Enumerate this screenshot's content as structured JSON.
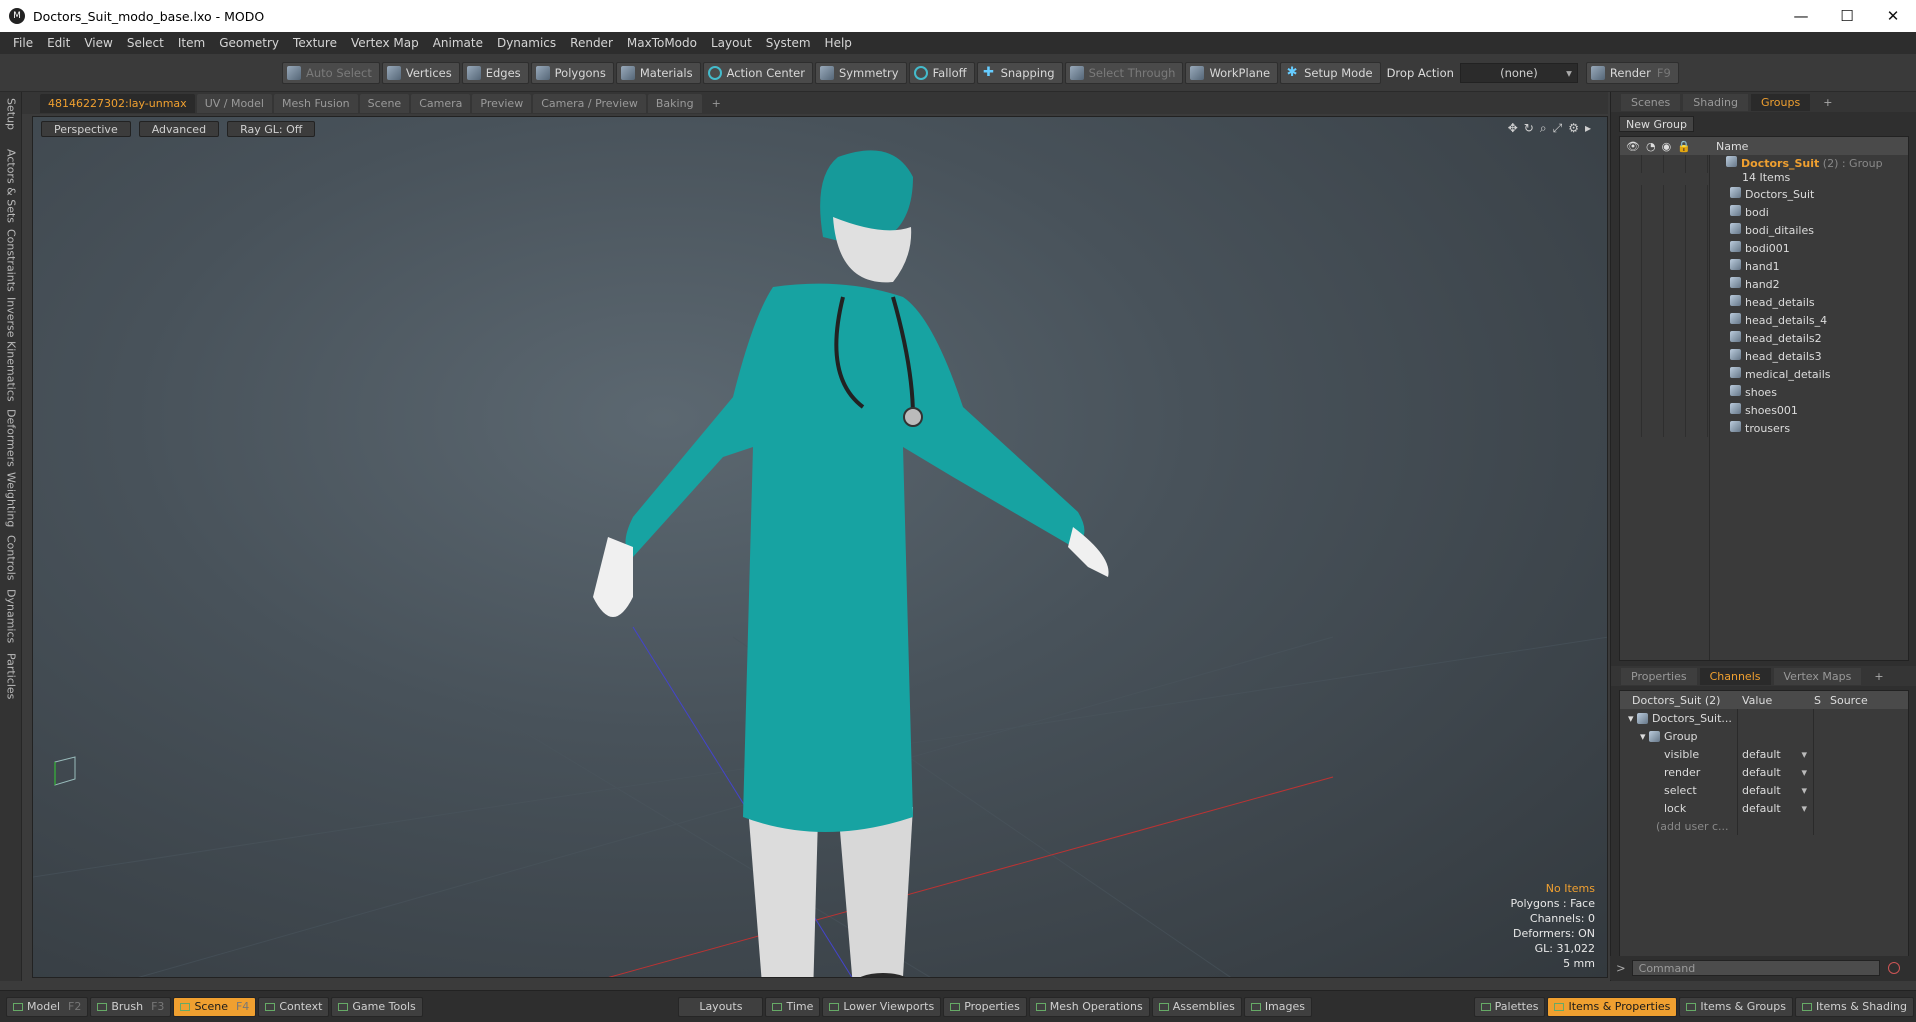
{
  "window": {
    "title": "Doctors_Suit_modo_base.lxo - MODO",
    "min": "—",
    "max": "☐",
    "close": "✕"
  },
  "menu": [
    "File",
    "Edit",
    "View",
    "Select",
    "Item",
    "Geometry",
    "Texture",
    "Vertex Map",
    "Animate",
    "Dynamics",
    "Render",
    "MaxToModo",
    "Layout",
    "System",
    "Help"
  ],
  "toolbar": {
    "auto_select": "Auto Select",
    "vertices": "Vertices",
    "edges": "Edges",
    "polygons": "Polygons",
    "materials": "Materials",
    "action_center": "Action Center",
    "symmetry": "Symmetry",
    "falloff": "Falloff",
    "snapping": "Snapping",
    "select_through": "Select Through",
    "workplane": "WorkPlane",
    "setup_mode": "Setup Mode",
    "drop_action": "Drop Action",
    "drop_value": "(none)",
    "render": "Render",
    "render_key": "F9"
  },
  "left_tabs": [
    "Setup",
    "Actors & Sets",
    "Constraints",
    "Inverse Kinematics",
    "Deformers",
    "Weighting",
    "Controls",
    "Dynamics",
    "Particles"
  ],
  "viewport_tabs": [
    "48146227302:lay-unmax",
    "UV / Model",
    "Mesh Fusion",
    "Scene",
    "Camera",
    "Preview",
    "Camera / Preview",
    "Baking",
    "+"
  ],
  "viewport": {
    "perspective": "Perspective",
    "advanced": "Advanced",
    "raygl": "Ray GL: Off",
    "info": {
      "items": "No Items",
      "polygons": "Polygons : Face",
      "channels": "Channels: 0",
      "deformers": "Deformers: ON",
      "gl": "GL: 31,022",
      "scale": "5 mm"
    }
  },
  "groups_panel": {
    "tabs": [
      "Scenes",
      "Shading",
      "Groups",
      "+"
    ],
    "new_group": "New Group",
    "col_name": "Name",
    "group_name": "Doctors_Suit",
    "group_suffix": "(2) : Group",
    "items_count": "14 Items",
    "items": [
      "Doctors_Suit",
      "bodi",
      "bodi_ditailes",
      "bodi001",
      "hand1",
      "hand2",
      "head_details",
      "head_details_4",
      "head_details2",
      "head_details3",
      "medical_details",
      "shoes",
      "shoes001",
      "trousers"
    ]
  },
  "channels_panel": {
    "tabs": [
      "Properties",
      "Channels",
      "Vertex Maps",
      "+"
    ],
    "col_name": "Doctors_Suit (2)",
    "col_value": "Value",
    "col_s": "S",
    "col_source": "Source",
    "root": "Doctors_Suit...",
    "group": "Group",
    "rows": [
      {
        "name": "visible",
        "value": "default"
      },
      {
        "name": "render",
        "value": "default"
      },
      {
        "name": "select",
        "value": "default"
      },
      {
        "name": "lock",
        "value": "default"
      }
    ],
    "add": "(add user c..."
  },
  "command": {
    "placeholder": "Command"
  },
  "bottom": {
    "model": "Model",
    "model_key": "F2",
    "brush": "Brush",
    "brush_key": "F3",
    "scene": "Scene",
    "scene_key": "F4",
    "context": "Context",
    "game_tools": "Game Tools",
    "layouts": "Layouts",
    "time": "Time",
    "lower_viewports": "Lower Viewports",
    "properties": "Properties",
    "mesh_operations": "Mesh Operations",
    "assemblies": "Assemblies",
    "images": "Images",
    "palettes": "Palettes",
    "items_properties": "Items & Properties",
    "items_groups": "Items & Groups",
    "items_shading": "Items & Shading"
  }
}
